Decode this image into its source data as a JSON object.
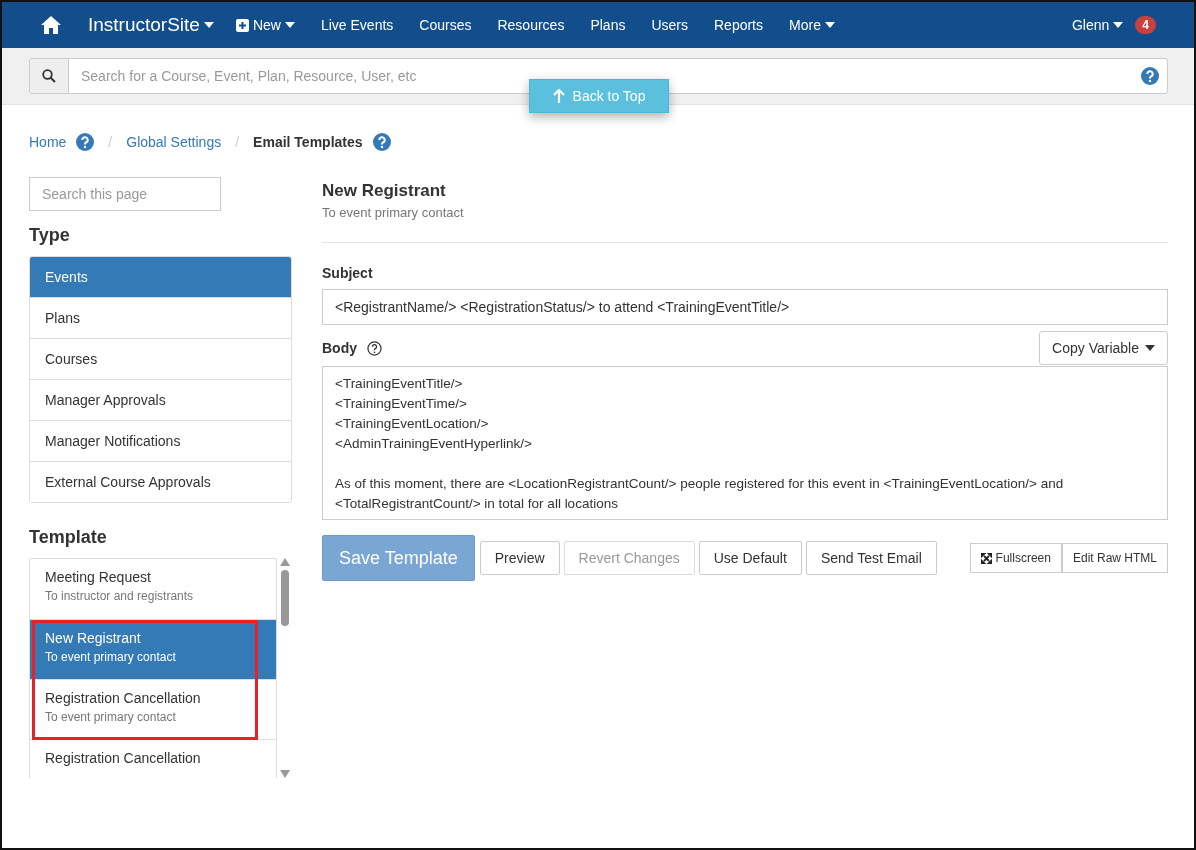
{
  "navbar": {
    "brand": "InstructorSite",
    "new_label": "New",
    "links": [
      "Live Events",
      "Courses",
      "Resources",
      "Plans",
      "Users",
      "Reports"
    ],
    "more_label": "More",
    "user": "Glenn",
    "notification_count": "4"
  },
  "search": {
    "placeholder": "Search for a Course, Event, Plan, Resource, User, etc"
  },
  "back_to_top": "Back to Top",
  "breadcrumb": [
    {
      "label": "Home",
      "current": false,
      "help": true
    },
    {
      "separator": "/",
      "label": "Global Settings",
      "current": false,
      "help": false
    },
    {
      "separator": "/",
      "label": "Email Templates",
      "current": true,
      "help": true
    }
  ],
  "sidebar": {
    "search_placeholder": "Search this page",
    "type_heading": "Type",
    "types": [
      {
        "label": "Events",
        "selected": true
      },
      {
        "label": "Plans",
        "selected": false
      },
      {
        "label": "Courses",
        "selected": false
      },
      {
        "label": "Manager Approvals",
        "selected": false
      },
      {
        "label": "Manager Notifications",
        "selected": false
      },
      {
        "label": "External Course Approvals",
        "selected": false
      }
    ],
    "template_heading": "Template",
    "templates": [
      {
        "title": "Meeting Request",
        "subtitle": "To instructor and registrants",
        "selected": false,
        "highlighted": false
      },
      {
        "title": "New Registrant",
        "subtitle": "To event primary contact",
        "selected": true,
        "highlighted": true
      },
      {
        "title": "Registration Cancellation",
        "subtitle": "To event primary contact",
        "selected": false,
        "highlighted": true
      },
      {
        "title": "Registration Cancellation",
        "selected": false,
        "highlighted": false
      }
    ]
  },
  "editor": {
    "title": "New Registrant",
    "subtitle": "To event primary contact",
    "subject_label": "Subject",
    "subject": "<RegistrantName/> <RegistrationStatus/> to attend <TrainingEventTitle/>",
    "body_label": "Body",
    "copy_variable": "Copy Variable",
    "body": "<TrainingEventTitle/>\n<TrainingEventTime/>\n<TrainingEventLocation/>\n<AdminTrainingEventHyperlink/>\n\nAs of this moment, there are <LocationRegistrantCount/> people registered for this event in <TrainingEventLocation/> and <TotalRegistrantCount/> in total for all locations",
    "buttons": [
      {
        "label": "Save Template",
        "kind": "primary",
        "disabled": false
      },
      {
        "label": "Preview",
        "kind": "default",
        "disabled": false
      },
      {
        "label": "Revert Changes",
        "kind": "default",
        "disabled": true
      },
      {
        "label": "Use Default",
        "kind": "default",
        "disabled": false
      },
      {
        "label": "Send Test Email",
        "kind": "default",
        "disabled": false
      }
    ],
    "fullscreen": "Fullscreen",
    "edit_raw_html": "Edit Raw HTML"
  }
}
